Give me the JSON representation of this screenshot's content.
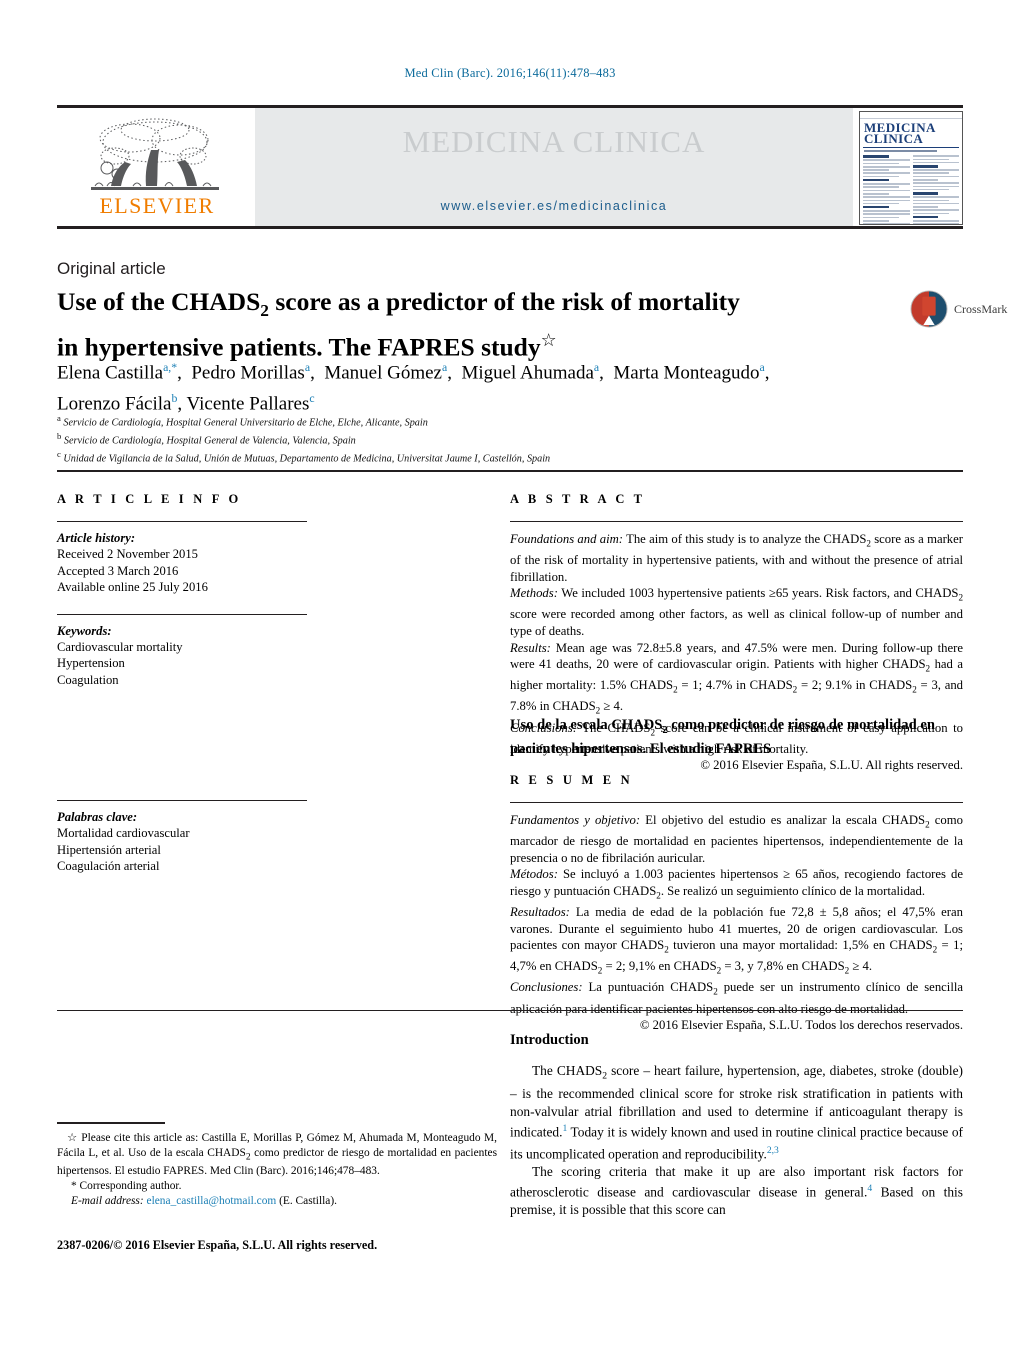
{
  "running_head": {
    "prefix": "Med Clin (Barc). 2016;",
    "volume": "146",
    "issue": "(11)",
    "pages": ":478–483",
    "full": "Med Clin (Barc). 2016;146(11):478–483",
    "color": "#0b6a9b"
  },
  "masthead": {
    "publisher": "ELSEVIER",
    "journal_title": "MEDICINA CLINICA",
    "url": "www.elsevier.es/medicinaclinica",
    "cover_title_line1": "MEDICINA",
    "cover_title_line2": "CLINICA",
    "band_color": "#e7e9ea",
    "url_color": "#1b5c8c",
    "elsevier_color": "#f07d00"
  },
  "article": {
    "type": "Original article",
    "title_line1_a": "Use of the CHADS",
    "title_line1_sub": "2",
    "title_line1_b": " score as a predictor of the risk of mortality",
    "title_line2": "in hypertensive patients. The FAPRES study",
    "title_dagger": "☆",
    "crossmark_label": "CrossMark",
    "authors_line1": "Elena Castilla",
    "authors": "Elena Castilla a,*, Pedro Morillas a, Manuel Gómez a, Miguel Ahumada a, Marta Monteagudo a, Lorenzo Fácila b, Vicente Pallares c",
    "affiliations": [
      {
        "mark": "a",
        "text": "Servicio de Cardiología, Hospital General Universitario de Elche, Elche, Alicante, Spain"
      },
      {
        "mark": "b",
        "text": "Servicio de Cardiología, Hospital General de Valencia, Valencia, Spain"
      },
      {
        "mark": "c",
        "text": "Unidad de Vigilancia de la Salud, Unión de Mutuas, Departamento de Medicina, Universitat Jaume I, Castellón, Spain"
      }
    ]
  },
  "article_info": {
    "heading": "A R T I C L E    I N F O",
    "history_label": "Article history:",
    "history": [
      "Received 2 November 2015",
      "Accepted 3 March 2016",
      "Available online 25 July 2016"
    ],
    "keywords_label": "Keywords:",
    "keywords": [
      "Cardiovascular mortality",
      "Hypertension",
      "Coagulation"
    ],
    "palabras_label": "Palabras clave:",
    "palabras": [
      "Mortalidad cardiovascular",
      "Hipertensión arterial",
      "Coagulación arterial"
    ]
  },
  "abstract_en": {
    "heading": "A B S T R A C T",
    "sections": [
      {
        "lead": "Foundations and aim:",
        "text": " The aim of this study is to analyze the CHADS2 score as a marker of the risk of mortality in hypertensive patients, with and without the presence of atrial fibrillation."
      },
      {
        "lead": "Methods:",
        "text": " We included 1003 hypertensive patients ≥65 years. Risk factors, and CHADS2 score were recorded among other factors, as well as clinical follow-up of number and type of deaths."
      },
      {
        "lead": "Results:",
        "text": " Mean age was 72.8±5.8 years, and 47.5% were men. During follow-up there were 41 deaths, 20 were of cardiovascular origin. Patients with higher CHADS2 had a higher mortality: 1.5% CHADS2 = 1; 4.7% in CHADS2 = 2; 9.1% in CHADS2 = 3, and 7.8% in CHADS2 ≥ 4."
      },
      {
        "lead": "Conclusions:",
        "text": " The CHADS2 score can be a clinical instrument of easy application to identify hypertensive patients with a high risk of mortality."
      }
    ],
    "copyright": "© 2016 Elsevier España, S.L.U. All rights reserved."
  },
  "abstract_es": {
    "title_line1_a": "Uso de la escala CHADS",
    "title_line1_sub": "2",
    "title_line1_b": " como predictor de riesgo de mortalidad en pacientes",
    "title_line2": "hipertensos. El estudio FAPRES",
    "heading": "R E S U M E N",
    "sections": [
      {
        "lead": "Fundamentos y objetivo:",
        "text": " El objetivo del estudio es analizar la escala CHADS2 como marcador de riesgo de mortalidad en pacientes hipertensos, independientemente de la presencia o no de fibrilación auricular."
      },
      {
        "lead": "Métodos:",
        "text": " Se incluyó a 1.003 pacientes hipertensos ≥ 65 años, recogiendo factores de riesgo y puntuación CHADS2. Se realizó un seguimiento clínico de la mortalidad."
      },
      {
        "lead": "Resultados:",
        "text": " La media de edad de la población fue 72,8 ± 5,8 años; el 47,5% eran varones. Durante el seguimiento hubo 41 muertes, 20 de origen cardiovascular. Los pacientes con mayor CHADS2 tuvieron una mayor mortalidad: 1,5% en CHADS2 = 1; 4,7% en CHADS2 = 2; 9,1% en CHADS2 = 3, y 7,8% en CHADS2 ≥ 4."
      },
      {
        "lead": "Conclusiones:",
        "text": " La puntuación CHADS2 puede ser un instrumento clínico de sencilla aplicación para identificar pacientes hipertensos con alto riesgo de mortalidad."
      }
    ],
    "copyright": "© 2016 Elsevier España, S.L.U. Todos los derechos reservados."
  },
  "introduction": {
    "heading": "Introduction",
    "p1_a": "The CHADS",
    "p1_sub": "2",
    "p1_b": " score – heart failure, hypertension, age, diabetes, stroke (double) – is the recommended clinical score for stroke risk stratification in patients with non-valvular atrial fibrillation and used to determine if anticoagulant therapy is indicated.",
    "p1_ref1": "1",
    "p1_c": " Today it is widely known and used in routine clinical practice because of its uncomplicated operation and reproducibility.",
    "p1_ref2": "2,3",
    "p2_a": "The scoring criteria that make it up are also important risk factors for atherosclerotic disease and cardiovascular disease in general.",
    "p2_ref": "4",
    "p2_b": " Based on this premise, it is possible that this score can"
  },
  "footnotes": {
    "cite_star": "☆",
    "cite_text": " Please cite this article as: Castilla E, Morillas P, Gómez M, Ahumada M, Monteagudo M, Fácila L, et al. Uso de la escala CHADS2 como predictor de riesgo de mortalidad en pacientes hipertensos. El estudio FAPRES. Med Clin (Barc). 2016;146;478–483.",
    "corresponding": "* Corresponding author.",
    "email_label": "E-mail address:",
    "email": "elena_castilla@hotmail.com",
    "email_suffix": " (E. Castilla).",
    "issn_line": "2387-0206/© 2016 Elsevier España, S.L.U. All rights reserved.",
    "link_color": "#1b7fb5"
  }
}
